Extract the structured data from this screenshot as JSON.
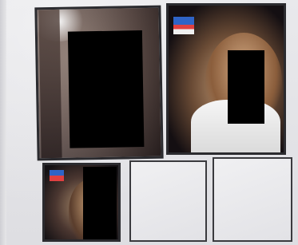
{
  "collage": {
    "photos": [
      {
        "content": "redacted"
      },
      {
        "content": "redacted"
      },
      {
        "content": "redacted"
      }
    ],
    "placeholders": [
      {
        "content": "empty"
      },
      {
        "content": "empty"
      }
    ]
  }
}
